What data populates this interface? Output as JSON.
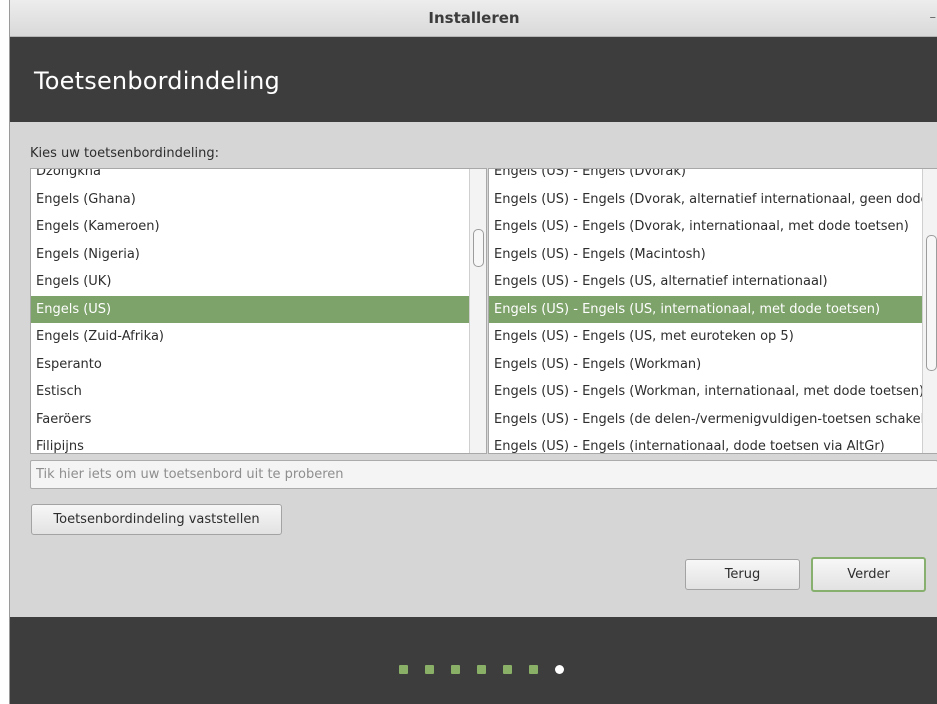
{
  "window": {
    "title": "Installeren",
    "minimize_glyph": "–"
  },
  "header": {
    "title": "Toetsenbordindeling"
  },
  "prompt": "Kies uw toetsenbordindeling:",
  "layouts": {
    "items": [
      "Dzongkha",
      "Engels (Ghana)",
      "Engels (Kameroen)",
      "Engels (Nigeria)",
      "Engels (UK)",
      "Engels (US)",
      "Engels (Zuid-Afrika)",
      "Esperanto",
      "Estisch",
      "Faeröers",
      "Filipijns"
    ],
    "selected": "Engels (US)"
  },
  "variants": {
    "items": [
      "Engels (US) - Engels (Dvorak)",
      "Engels (US) - Engels (Dvorak, alternatief internationaal, geen dode toetsen)",
      "Engels (US) - Engels (Dvorak, internationaal, met dode toetsen)",
      "Engels (US) - Engels (Macintosh)",
      "Engels (US) - Engels (US, alternatief internationaal)",
      "Engels (US) - Engels (US, internationaal, met dode toetsen)",
      "Engels (US) - Engels (US, met euroteken op 5)",
      "Engels (US) - Engels (Workman)",
      "Engels (US) - Engels (Workman, internationaal, met dode toetsen)",
      "Engels (US) - Engels (de delen-/vermenigvuldigen-toetsen schakelen over)",
      "Engels (US) - Engels (internationaal, dode toetsen via AltGr)"
    ],
    "selected": "Engels (US) - Engels (US, internationaal, met dode toetsen)"
  },
  "test_input": {
    "value": "",
    "placeholder": "Tik hier iets om uw toetsenbord uit te proberen"
  },
  "buttons": {
    "detect": "Toetsenbordindeling vaststellen",
    "back": "Terug",
    "forward": "Verder"
  },
  "progress": {
    "total_steps": 7,
    "current_step": 7
  },
  "colors": {
    "accent": "#7da26a",
    "header_bg": "#3d3d3d",
    "progress_dot": "#8aaf66"
  }
}
